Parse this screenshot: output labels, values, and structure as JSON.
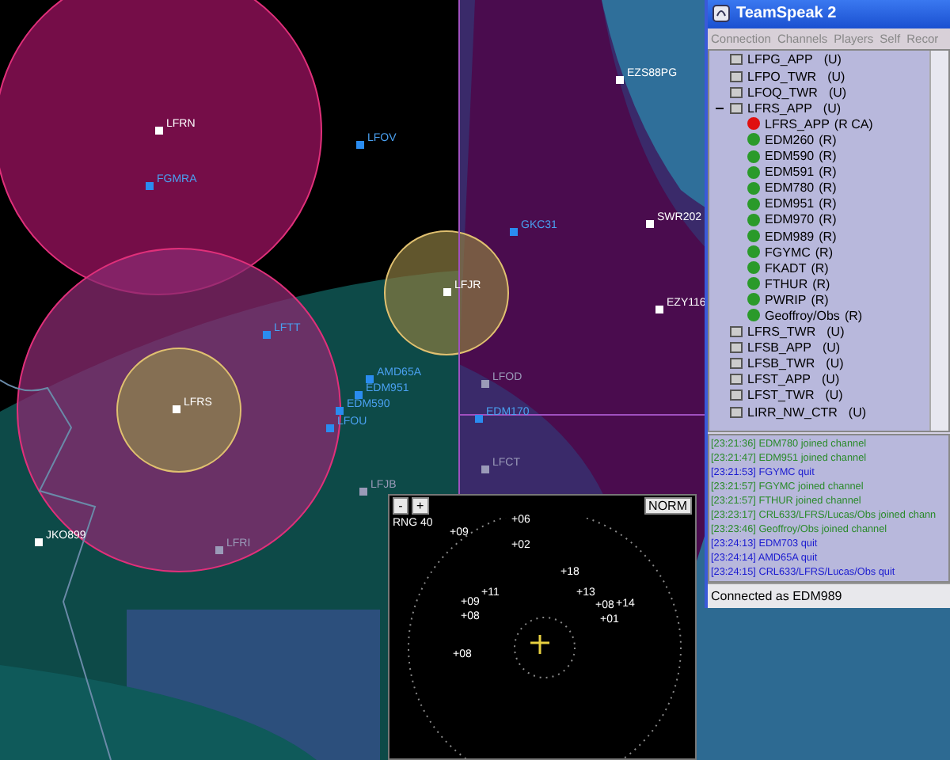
{
  "map": {
    "markers": [
      {
        "kind": "airport",
        "label": "LFRN"
      },
      {
        "kind": "aircraft",
        "label": "FGMRA"
      },
      {
        "kind": "aircraft",
        "label": "LFOV"
      },
      {
        "kind": "airport",
        "label": "EZS88PG"
      },
      {
        "kind": "aircraft",
        "label": "GKC31"
      },
      {
        "kind": "airport",
        "label": "SWR202"
      },
      {
        "kind": "airport",
        "label": "LFJR"
      },
      {
        "kind": "airport",
        "label": "EZY116"
      },
      {
        "kind": "aircraft",
        "label": "LFTT"
      },
      {
        "kind": "field",
        "label": "LFOD"
      },
      {
        "kind": "aircraft",
        "label": "EDM170"
      },
      {
        "kind": "airport",
        "label": "LFRS"
      },
      {
        "kind": "aircraft",
        "label": "AMD65A"
      },
      {
        "kind": "aircraft",
        "label": "EDM951"
      },
      {
        "kind": "aircraft",
        "label": "EDM590"
      },
      {
        "kind": "aircraft",
        "label": "LFOU"
      },
      {
        "kind": "field",
        "label": "LFJB"
      },
      {
        "kind": "field",
        "label": "LFCT"
      },
      {
        "kind": "airport",
        "label": "JKO899"
      },
      {
        "kind": "field",
        "label": "LFRI"
      }
    ]
  },
  "scope": {
    "zoom_out": "-",
    "zoom_in": "+",
    "range": "RNG 40",
    "mode": "NORM",
    "blips": [
      "+09",
      "+06",
      "+02",
      "+18",
      "+11",
      "+09",
      "+08",
      "+13",
      "+08",
      "+14",
      "+01",
      "+08"
    ]
  },
  "window": {
    "title": "TeamSpeak 2",
    "menu": [
      "Connection",
      "Channels",
      "Players",
      "Self",
      "Recor"
    ],
    "channels": [
      {
        "name": "LFPG_APP",
        "flag": "(U)"
      },
      {
        "name": "LFPO_TWR",
        "flag": "(U)"
      },
      {
        "name": "LFOQ_TWR",
        "flag": "(U)"
      },
      {
        "name": "LFRS_APP",
        "flag": "(U)",
        "players": [
          {
            "name": "LFRS_APP",
            "flag": "(R CA)",
            "color": "#e01010"
          },
          {
            "name": "EDM260",
            "flag": "(R)",
            "color": "#2a9a2a"
          },
          {
            "name": "EDM590",
            "flag": "(R)",
            "color": "#2a9a2a"
          },
          {
            "name": "EDM591",
            "flag": "(R)",
            "color": "#2a9a2a"
          },
          {
            "name": "EDM780",
            "flag": "(R)",
            "color": "#2a9a2a"
          },
          {
            "name": "EDM951",
            "flag": "(R)",
            "color": "#2a9a2a"
          },
          {
            "name": "EDM970",
            "flag": "(R)",
            "color": "#2a9a2a"
          },
          {
            "name": "EDM989",
            "flag": "(R)",
            "color": "#2a9a2a"
          },
          {
            "name": "FGYMC",
            "flag": "(R)",
            "color": "#2a9a2a"
          },
          {
            "name": "FKADT",
            "flag": "(R)",
            "color": "#2a9a2a"
          },
          {
            "name": "FTHUR",
            "flag": "(R)",
            "color": "#2a9a2a"
          },
          {
            "name": "PWRIP",
            "flag": "(R)",
            "color": "#2a9a2a"
          },
          {
            "name": "Geoffroy/Obs",
            "flag": "(R)",
            "color": "#2a9a2a"
          }
        ]
      },
      {
        "name": "LFRS_TWR",
        "flag": "(U)"
      },
      {
        "name": "LFSB_APP",
        "flag": "(U)"
      },
      {
        "name": "LFSB_TWR",
        "flag": "(U)"
      },
      {
        "name": "LFST_APP",
        "flag": "(U)"
      },
      {
        "name": "LFST_TWR",
        "flag": "(U)"
      },
      {
        "name": "LIRR_NW_CTR",
        "flag": "(U)"
      }
    ],
    "log": [
      {
        "time": "[23:21:36]",
        "text": "EDM780 joined channel",
        "kind": "join"
      },
      {
        "time": "[23:21:47]",
        "text": "EDM951 joined channel",
        "kind": "join"
      },
      {
        "time": "[23:21:53]",
        "text": "FGYMC quit",
        "kind": "quit"
      },
      {
        "time": "[23:21:57]",
        "text": "FGYMC joined channel",
        "kind": "join"
      },
      {
        "time": "[23:21:57]",
        "text": "FTHUR joined channel",
        "kind": "join"
      },
      {
        "time": "[23:23:17]",
        "text": "CRL633/LFRS/Lucas/Obs joined chann",
        "kind": "join"
      },
      {
        "time": "[23:23:46]",
        "text": "Geoffroy/Obs joined channel",
        "kind": "join"
      },
      {
        "time": "[23:24:13]",
        "text": "EDM703 quit",
        "kind": "quit"
      },
      {
        "time": "[23:24:14]",
        "text": "AMD65A quit",
        "kind": "quit"
      },
      {
        "time": "[23:24:15]",
        "text": "CRL633/LFRS/Lucas/Obs quit",
        "kind": "quit"
      }
    ],
    "status_bar": "Connected as EDM989"
  }
}
